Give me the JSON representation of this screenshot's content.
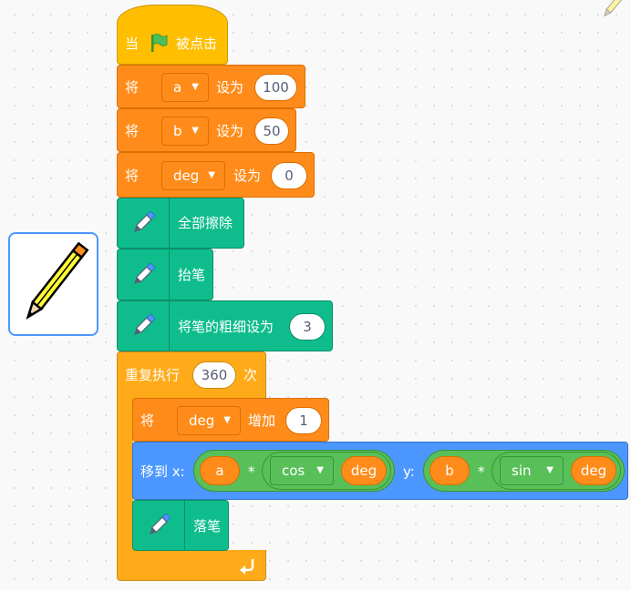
{
  "colors": {
    "events": "#ffbf00",
    "variables": "#ff8c1a",
    "control": "#ffab19",
    "pen": "#0fbd8c",
    "motion": "#4c97ff",
    "operators": "#59c059"
  },
  "icons": [
    "green-flag-icon",
    "pen-extension-icon",
    "repeat-arrow-icon",
    "pencil-sprite-thumbnail",
    "pencil-corner-icon"
  ],
  "script": {
    "hat": {
      "prefix": "当",
      "suffix": "被点击"
    },
    "set_a": {
      "verb": "将",
      "variable": "a",
      "action": "设为",
      "value": "100"
    },
    "set_b": {
      "verb": "将",
      "variable": "b",
      "action": "设为",
      "value": "50"
    },
    "set_deg": {
      "verb": "将",
      "variable": "deg",
      "action": "设为",
      "value": "0"
    },
    "pen_clear": {
      "label": "全部擦除"
    },
    "pen_up": {
      "label": "抬笔"
    },
    "pen_size": {
      "label": "将笔的粗细设为",
      "value": "3"
    },
    "repeat": {
      "label": "重复执行",
      "count": "360",
      "suffix": "次"
    },
    "change_deg": {
      "verb": "将",
      "variable": "deg",
      "action": "增加",
      "value": "1"
    },
    "goto": {
      "label": "移到 x:",
      "y_label": "y:",
      "x_left": "a",
      "x_op": "*",
      "x_func": "cos",
      "x_arg": "deg",
      "y_left": "b",
      "y_op": "*",
      "y_func": "sin",
      "y_arg": "deg"
    },
    "pen_down": {
      "label": "落笔"
    }
  }
}
